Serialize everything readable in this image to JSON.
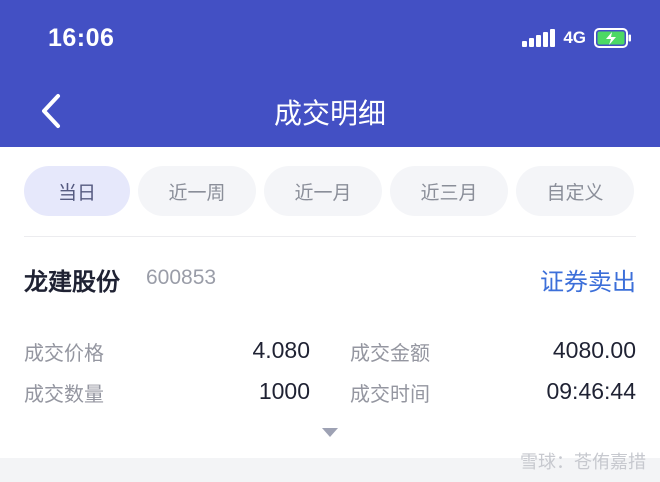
{
  "status_bar": {
    "time": "16:06",
    "network": "4G"
  },
  "header": {
    "title": "成交明细"
  },
  "tabs": [
    {
      "label": "当日",
      "active": true
    },
    {
      "label": "近一周",
      "active": false
    },
    {
      "label": "近一月",
      "active": false
    },
    {
      "label": "近三月",
      "active": false
    },
    {
      "label": "自定义",
      "active": false
    }
  ],
  "trade": {
    "stock_name": "龙建股份",
    "stock_code": "600853",
    "trade_type": "证券卖出",
    "fields": {
      "price_label": "成交价格",
      "price_value": "4.080",
      "amount_label": "成交金额",
      "amount_value": "4080.00",
      "quantity_label": "成交数量",
      "quantity_value": "1000",
      "time_label": "成交时间",
      "time_value": "09:46:44"
    }
  },
  "watermark": {
    "text": "雪球：苍侑嘉措"
  },
  "colors": {
    "header_bg": "#4350c4",
    "active_tab_bg": "#e6e8fb",
    "link_blue": "#3c6fd9"
  }
}
